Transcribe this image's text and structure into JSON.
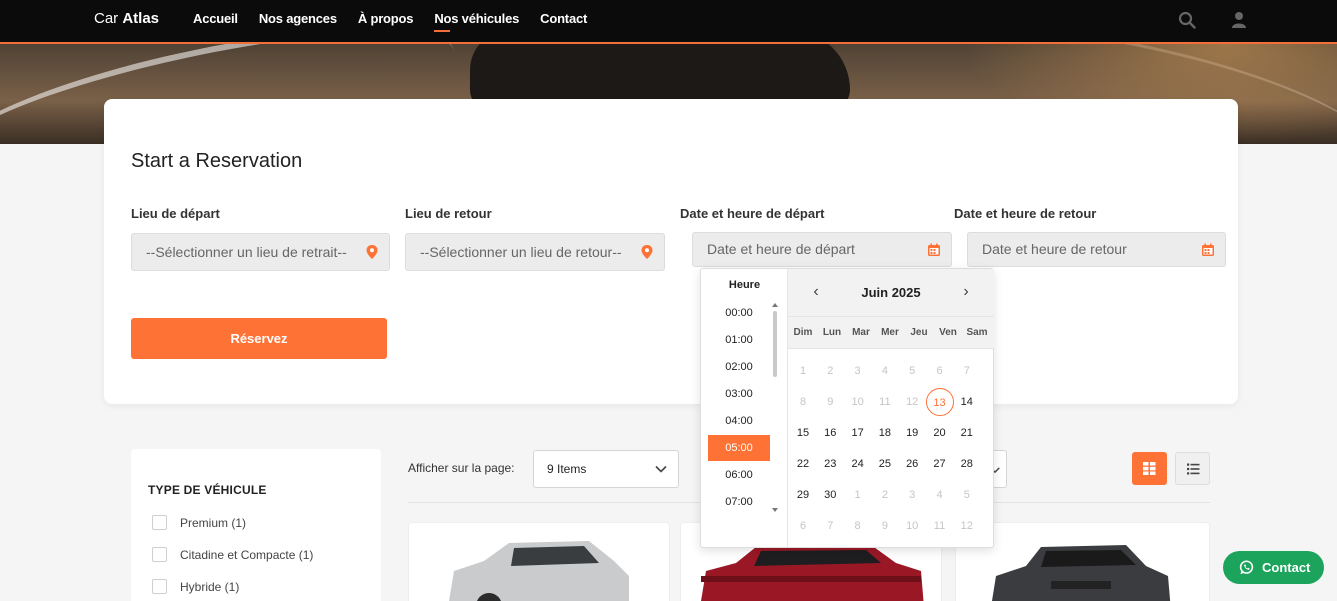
{
  "brand": {
    "light": "Car ",
    "bold": "Atlas"
  },
  "nav": {
    "items": [
      "Accueil",
      "Nos agences",
      "À propos",
      "Nos véhicules",
      "Contact"
    ],
    "active_index": 3
  },
  "icons": {
    "search": "search-icon",
    "user": "user-icon",
    "pin": "map-pin-icon",
    "calendar": "calendar-icon",
    "chevron": "chevron-down-icon",
    "grid": "grid-view-icon",
    "list": "list-view-icon",
    "whatsapp": "whatsapp-icon"
  },
  "colors": {
    "accent": "#ff7236",
    "nav_bg": "#0b0b0b",
    "whatsapp": "#1ca35c"
  },
  "reservation": {
    "title": "Start a Reservation",
    "pickup_label": "Lieu de départ",
    "pickup_placeholder": "--Sélectionner un lieu de retrait--",
    "return_label": "Lieu de retour",
    "return_placeholder": "--Sélectionner un lieu de retour--",
    "start_label": "Date et heure de départ",
    "start_placeholder": "Date et heure de départ",
    "end_label": "Date et heure de retour",
    "end_placeholder": "Date et heure de retour",
    "submit": "Réservez"
  },
  "datepicker": {
    "time_title": "Heure",
    "times": [
      "00:00",
      "01:00",
      "02:00",
      "03:00",
      "04:00",
      "05:00",
      "06:00",
      "07:00"
    ],
    "selected_time_index": 5,
    "month": "Juin 2025",
    "prev": "‹",
    "next": "›",
    "weekdays": [
      "Dim",
      "Lun",
      "Mar",
      "Mer",
      "Jeu",
      "Ven",
      "Sam"
    ],
    "weeks": [
      [
        "1",
        "2",
        "3",
        "4",
        "5",
        "6",
        "7"
      ],
      [
        "8",
        "9",
        "10",
        "11",
        "12",
        "13",
        "14"
      ],
      [
        "15",
        "16",
        "17",
        "18",
        "19",
        "20",
        "21"
      ],
      [
        "22",
        "23",
        "24",
        "25",
        "26",
        "27",
        "28"
      ],
      [
        "29",
        "30",
        "1",
        "2",
        "3",
        "4",
        "5"
      ],
      [
        "6",
        "7",
        "8",
        "9",
        "10",
        "11",
        "12"
      ]
    ],
    "today": "13"
  },
  "filters": {
    "title": "TYPE DE VÉHICULE",
    "items": [
      "Premium (1)",
      "Citadine et Compacte (1)",
      "Hybride (1)"
    ]
  },
  "listing": {
    "per_page_label": "Afficher sur la page:",
    "per_page_value": "9 Items"
  },
  "contact_button": "Contact"
}
